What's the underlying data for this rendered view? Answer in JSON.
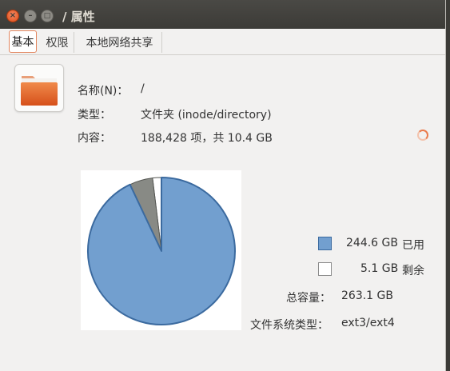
{
  "window": {
    "title": "/ 属性",
    "controls": {
      "close": "×",
      "minimize": "–",
      "maximize": "□"
    }
  },
  "tabs": [
    {
      "label": "基本",
      "active": true
    },
    {
      "label": "权限",
      "active": false
    },
    {
      "label": "本地网络共享",
      "active": false
    }
  ],
  "info": {
    "name_label": "名称(N)：",
    "name_value": "/",
    "type_label": "类型：",
    "type_value": "文件夹 (inode/directory)",
    "contents_label": "内容：",
    "contents_value": "188,428 项，共 10.4 GB"
  },
  "folder_icon": "folder-icon",
  "legend": {
    "used_value": "244.6 GB",
    "used_label": "已用",
    "free_value": "5.1 GB",
    "free_label": "剩余",
    "total_label": "总容量：",
    "total_value": "263.1 GB",
    "fs_label": "文件系统类型：",
    "fs_value": "ext3/ext4"
  },
  "colors": {
    "used": "#729fcf",
    "used_stroke": "#3b6a9f",
    "free": "#ffffff",
    "other": "#888a85"
  },
  "chart_data": {
    "type": "pie",
    "slices": [
      {
        "label": "已用",
        "value": 244.6,
        "color": "#729fcf"
      },
      {
        "label": "",
        "value": 13.4,
        "color": "#888a85"
      },
      {
        "label": "剩余",
        "value": 5.1,
        "color": "#ffffff"
      }
    ],
    "total": 263.1,
    "unit": "GB"
  }
}
